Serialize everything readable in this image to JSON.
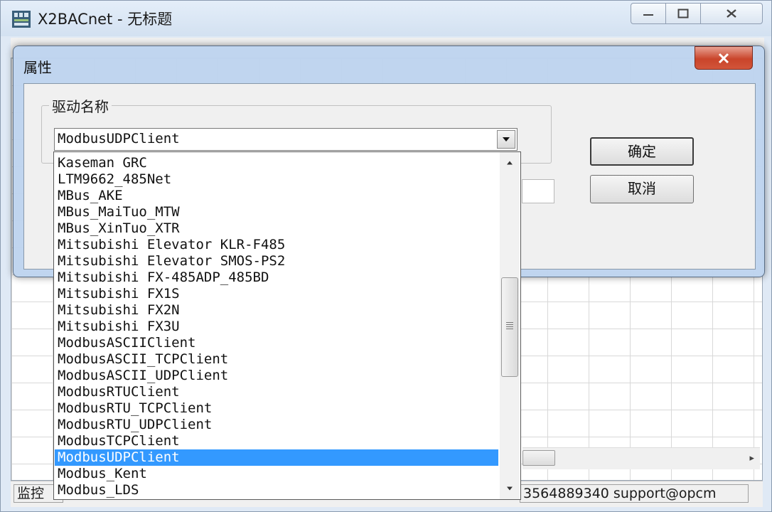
{
  "main_window": {
    "title": "X2BACnet - 无标题",
    "status": {
      "left_text": "监控",
      "right_text": "3564889340 support@opcm"
    }
  },
  "dialog": {
    "title": "属性",
    "group_label": "驱动名称",
    "selected_driver": "ModbusUDPClient",
    "ok_label": "确定",
    "cancel_label": "取消"
  },
  "dropdown": {
    "items": [
      {
        "label": "Kaseman GRC"
      },
      {
        "label": "LTM9662_485Net"
      },
      {
        "label": "MBus_AKE"
      },
      {
        "label": "MBus_MaiTuo_MTW"
      },
      {
        "label": "MBus_XinTuo_XTR"
      },
      {
        "label": "Mitsubishi Elevator KLR-F485"
      },
      {
        "label": "Mitsubishi Elevator SMOS-PS2"
      },
      {
        "label": "Mitsubishi FX-485ADP_485BD"
      },
      {
        "label": "Mitsubishi FX1S"
      },
      {
        "label": "Mitsubishi FX2N"
      },
      {
        "label": "Mitsubishi FX3U"
      },
      {
        "label": "ModbusASCIIClient"
      },
      {
        "label": "ModbusASCII_TCPClient"
      },
      {
        "label": "ModbusASCII_UDPClient"
      },
      {
        "label": "ModbusRTUClient"
      },
      {
        "label": "ModbusRTU_TCPClient"
      },
      {
        "label": "ModbusRTU_UDPClient"
      },
      {
        "label": "ModbusTCPClient"
      },
      {
        "label": "ModbusUDPClient"
      },
      {
        "label": "Modbus_Kent"
      },
      {
        "label": "Modbus_LDS"
      }
    ],
    "selected_index": 18
  },
  "colors": {
    "selection": "#3399ff",
    "close_button": "#c9442a"
  }
}
